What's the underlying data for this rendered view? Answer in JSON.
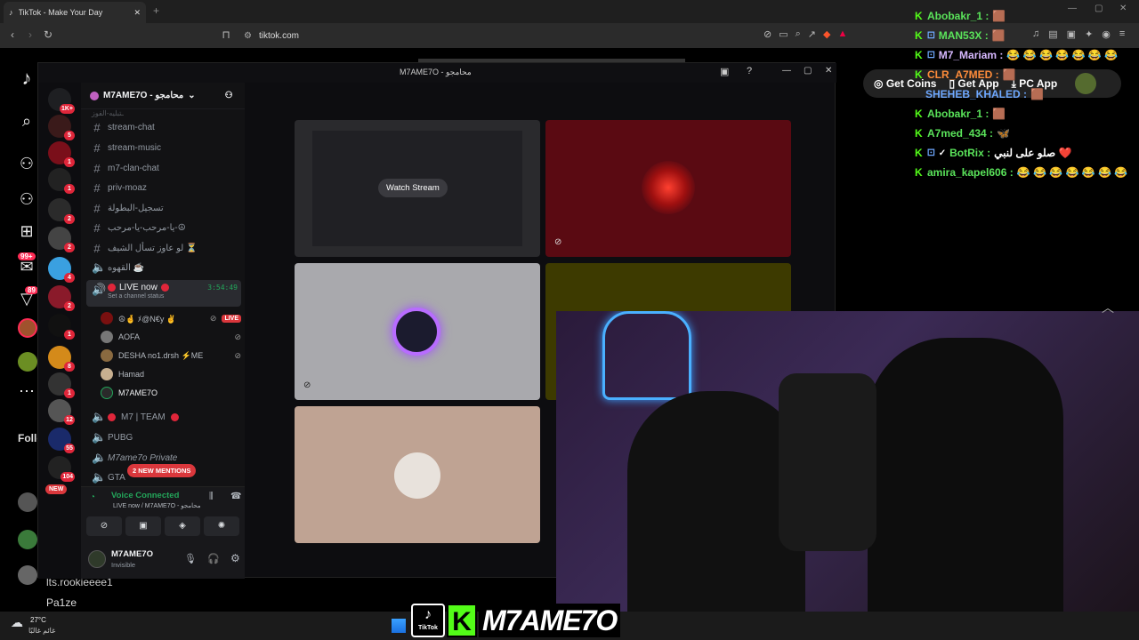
{
  "browser": {
    "tab_title": "TikTok - Make Your Day",
    "url": "tiktok.com"
  },
  "tiktok": {
    "get_coins": "Get Coins",
    "get_app": "Get App",
    "pc_app": "PC App",
    "following_label": "Follo",
    "badge_inbox": "99+",
    "badge_activity": "89",
    "bottom_users": [
      "lts.rookieeee1",
      "Pa1ze"
    ]
  },
  "discord": {
    "window_title": "M7AME7O - محامجو",
    "server_name": "M7AME7O - محامجو",
    "servers": [
      {
        "badge": "1K+"
      },
      {
        "badge": "5"
      },
      {
        "badge": "1"
      },
      {
        "badge": "1"
      },
      {
        "badge": "2"
      },
      {
        "badge": "2"
      },
      {
        "badge": "4"
      },
      {
        "badge": "2"
      },
      {
        "badge": "1"
      },
      {
        "badge": "8"
      },
      {
        "badge": "1"
      },
      {
        "badge": "12"
      },
      {
        "badge": "55"
      },
      {
        "badge": "104"
      },
      {
        "badge": "NEW"
      }
    ],
    "channels_top_cut": "ـتبليه-الفوز",
    "text_channels": [
      "stream-chat",
      "stream-music",
      "m7-clan-chat",
      "priv-moaz",
      "تسجيل-البطولة",
      "يا-مرحب-يا-مرحب-☮",
      "لو عاوز تسأل الشيف ⏳"
    ],
    "voice_channel_cafe": "القهوه ☕",
    "live_channel": {
      "label": "LIVE now",
      "timer": "3:54:49",
      "status": "Set a channel status"
    },
    "live_users": [
      {
        "name": "☮🤞 ﾒ@N€y ✌",
        "live": "LIVE"
      },
      {
        "name": "AOFA"
      },
      {
        "name": "DESHA no1.drsh ⚡ME"
      },
      {
        "name": "Hamad"
      },
      {
        "name": "M7AME7O"
      }
    ],
    "voice_channels": [
      "M7 | TEAM",
      "PUBG",
      "M7ame7o Private",
      "GTA"
    ],
    "new_mentions": "2 NEW MENTIONS",
    "voice_connected": "Voice Connected",
    "voice_sub": "LIVE now / M7AME7O - محامجو",
    "self_name": "M7AME7O",
    "self_status": "Invisible",
    "watch_stream": "Watch Stream"
  },
  "chat": [
    {
      "name": "Abobakr_1 :",
      "color": "green",
      "msg": "🟫"
    },
    {
      "name": "MAN53X :",
      "color": "green",
      "msg": "🟫"
    },
    {
      "name": "M7_Mariam :",
      "color": "purple",
      "msg": "😂 😂 😂 😂 😂 😂 😂"
    },
    {
      "name": "CLR_A7MED :",
      "color": "orange",
      "msg": "🟫"
    },
    {
      "name": "SHEHEB_KHALED :",
      "color": "blue",
      "msg": "🟫"
    },
    {
      "name": "Abobakr_1 :",
      "color": "green",
      "msg": "🟫"
    },
    {
      "name": "A7med_434 :",
      "color": "green",
      "msg": "🦋"
    },
    {
      "name": "BotRix :",
      "color": "green",
      "msg": "صلو على لنبي ❤️"
    },
    {
      "name": "amira_kapel606 :",
      "color": "green",
      "msg": "😂 😂 😂 😂 😂 😂 😂"
    }
  ],
  "overlay": {
    "kick_handle": "M7AME7O",
    "tiktok_label": "TikTok"
  },
  "taskbar": {
    "weather_temp": "27°C",
    "weather_desc": "غائم غالبًا"
  },
  "colors": {
    "kick_green": "#53fc18",
    "discord_bg": "#121214",
    "live_red": "#da373c"
  }
}
